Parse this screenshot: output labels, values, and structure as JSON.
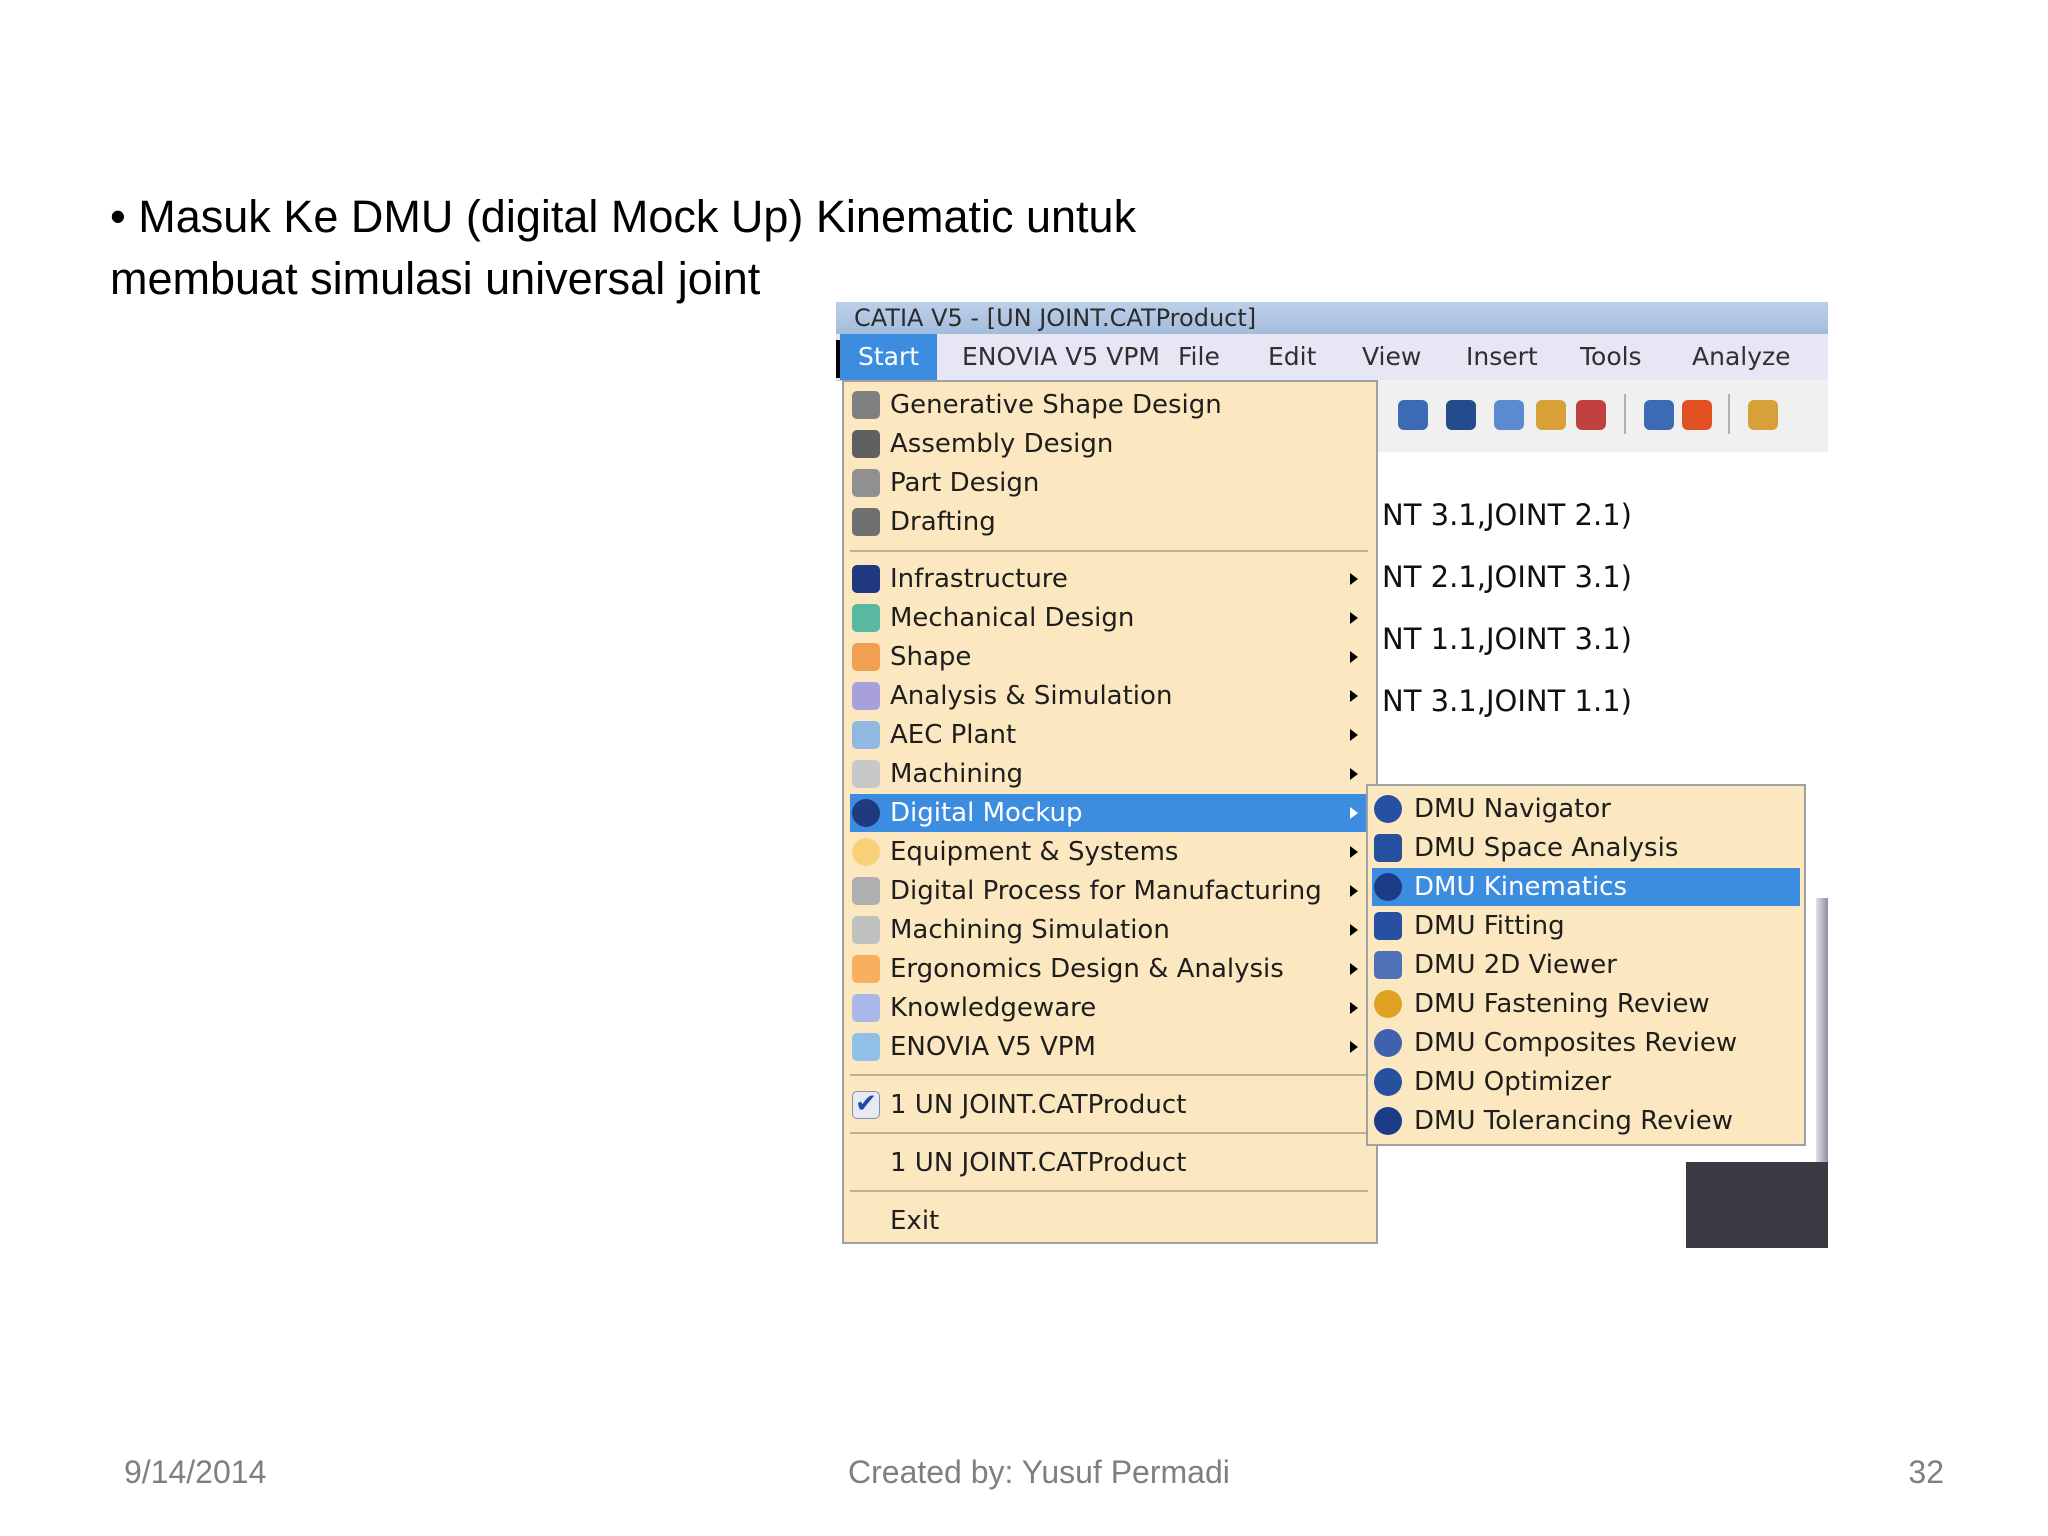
{
  "slide": {
    "bullet_line1": "• Masuk Ke DMU (digital Mock Up) Kinematic untuk",
    "bullet_line2": "membuat simulasi universal joint"
  },
  "footer": {
    "date": "9/14/2014",
    "credit": "Created by: Yusuf Permadi",
    "page": "32"
  },
  "window": {
    "title": "CATIA V5 - [UN JOINT.CATProduct]"
  },
  "menubar": [
    "Start",
    "ENOVIA V5 VPM",
    "File",
    "Edit",
    "View",
    "Insert",
    "Tools",
    "Analyze"
  ],
  "tree_lines": [
    "NT 3.1,JOINT 2.1)",
    "NT 2.1,JOINT 3.1)",
    "NT 1.1,JOINT 3.1)",
    "NT 3.1,JOINT 1.1)"
  ],
  "start_menu": {
    "group1": [
      "Generative Shape Design",
      "Assembly Design",
      "Part Design",
      "Drafting"
    ],
    "group2": [
      "Infrastructure",
      "Mechanical Design",
      "Shape",
      "Analysis & Simulation",
      "AEC Plant",
      "Machining",
      "Digital Mockup",
      "Equipment & Systems",
      "Digital Process for Manufacturing",
      "Machining Simulation",
      "Ergonomics Design & Analysis",
      "Knowledgeware",
      "ENOVIA V5 VPM"
    ],
    "selected": "Digital Mockup",
    "recent_checked": "1 UN JOINT.CATProduct",
    "recent": "1 UN JOINT.CATProduct",
    "exit": "Exit"
  },
  "submenu": {
    "items": [
      "DMU Navigator",
      "DMU Space Analysis",
      "DMU Kinematics",
      "DMU Fitting",
      "DMU 2D Viewer",
      "DMU Fastening Review",
      "DMU Composites Review",
      "DMU Optimizer",
      "DMU Tolerancing Review"
    ],
    "selected": "DMU Kinematics"
  },
  "colors": {
    "menu_bg": "#fce8c0",
    "highlight": "#3c8ce0",
    "titlebar": "#bcd0e8",
    "menubar": "#e6e6f4"
  }
}
